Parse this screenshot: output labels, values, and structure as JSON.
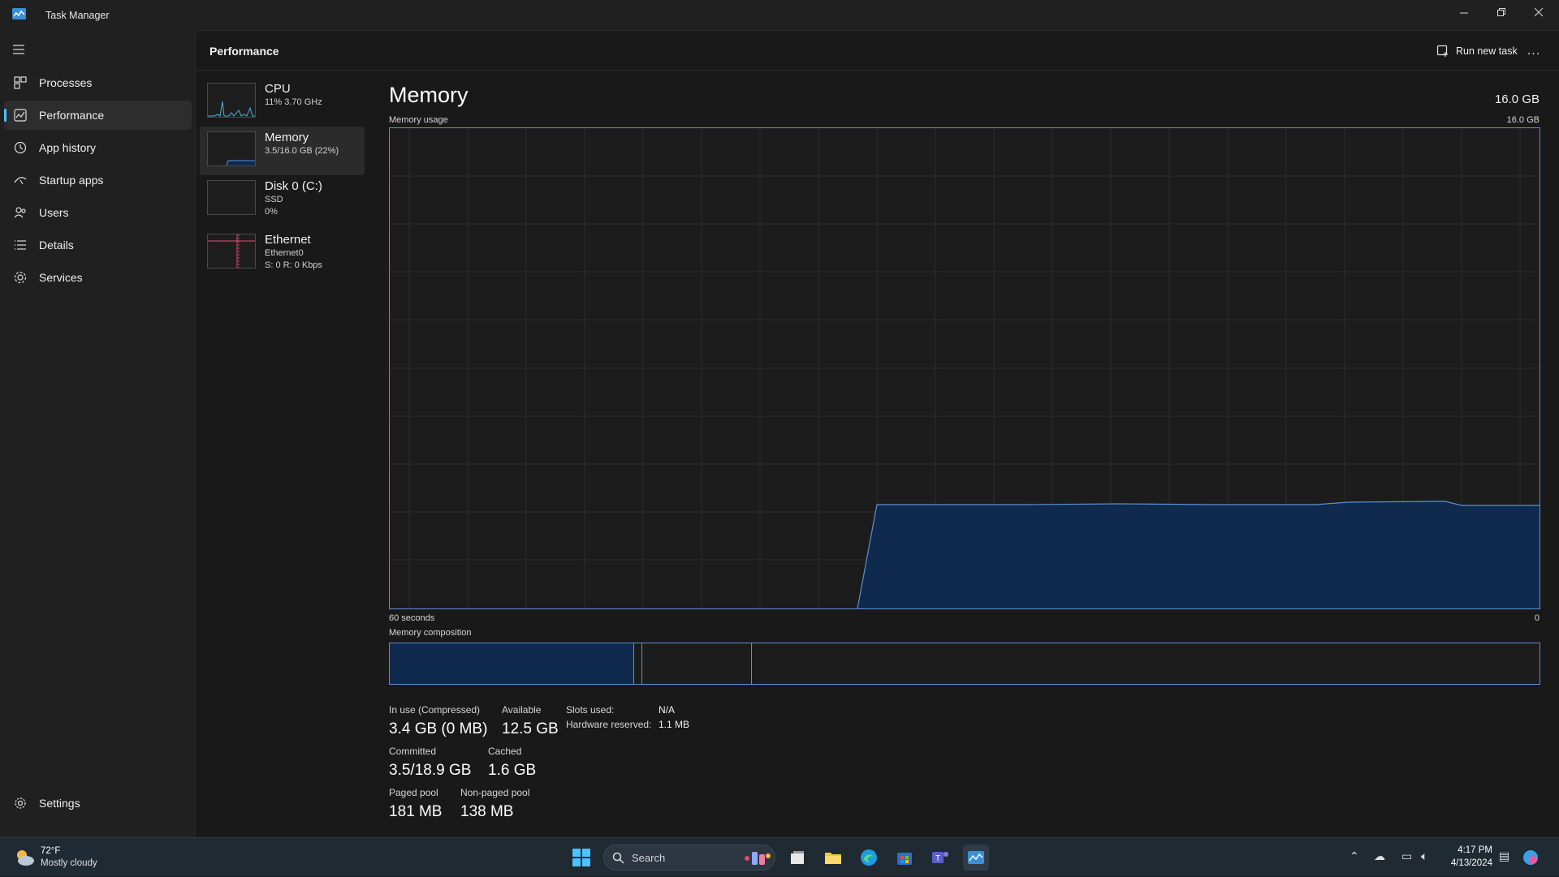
{
  "window": {
    "title": "Task Manager"
  },
  "sidebar": {
    "items": [
      {
        "label": "Processes",
        "icon": "processes-icon"
      },
      {
        "label": "Performance",
        "icon": "performance-icon",
        "active": true
      },
      {
        "label": "App history",
        "icon": "history-icon"
      },
      {
        "label": "Startup apps",
        "icon": "startup-icon"
      },
      {
        "label": "Users",
        "icon": "users-icon"
      },
      {
        "label": "Details",
        "icon": "details-icon"
      },
      {
        "label": "Services",
        "icon": "services-icon"
      }
    ],
    "settings_label": "Settings"
  },
  "header": {
    "title": "Performance",
    "run_new_task": "Run new task",
    "more": "..."
  },
  "resources": [
    {
      "name": "CPU",
      "sub1": "11% 3.70 GHz",
      "sub2": ""
    },
    {
      "name": "Memory",
      "sub1": "3.5/16.0 GB (22%)",
      "sub2": "",
      "active": true
    },
    {
      "name": "Disk 0 (C:)",
      "sub1": "SSD",
      "sub2": "0%"
    },
    {
      "name": "Ethernet",
      "sub1": "Ethernet0",
      "sub2": "S: 0 R: 0 Kbps"
    }
  ],
  "detail": {
    "title": "Memory",
    "total": "16.0 GB",
    "usage_label": "Memory usage",
    "usage_max": "16.0 GB",
    "axis_left": "60 seconds",
    "axis_right": "0",
    "composition_label": "Memory composition",
    "stats": {
      "in_use_label": "In use (Compressed)",
      "in_use_value": "3.4 GB (0 MB)",
      "available_label": "Available",
      "available_value": "12.5 GB",
      "committed_label": "Committed",
      "committed_value": "3.5/18.9 GB",
      "cached_label": "Cached",
      "cached_value": "1.6 GB",
      "paged_label": "Paged pool",
      "paged_value": "181 MB",
      "nonpaged_label": "Non-paged pool",
      "nonpaged_value": "138 MB",
      "slots_label": "Slots used:",
      "slots_value": "N/A",
      "hw_label": "Hardware reserved:",
      "hw_value": "1.1 MB"
    }
  },
  "taskbar": {
    "weather_temp": "72°F",
    "weather_desc": "Mostly cloudy",
    "search_placeholder": "Search",
    "time": "4:17 PM",
    "date": "4/13/2024"
  },
  "colors": {
    "accent": "#4cc2ff",
    "memory_line": "#5b8fd6",
    "memory_fill": "#0f2a4d",
    "cpu_line": "#4ab0e0",
    "net_line": "#e0507a"
  }
}
